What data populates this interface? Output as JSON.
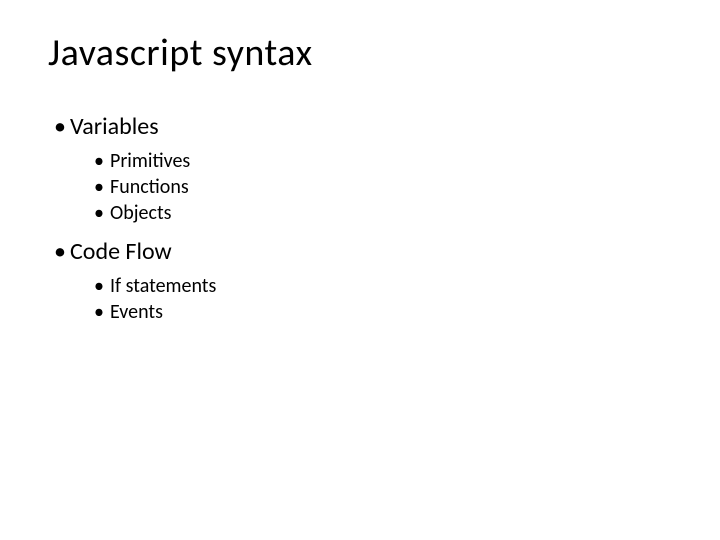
{
  "title": "Javascript syntax",
  "sections": [
    {
      "label": "Variables",
      "items": [
        "Primitives",
        "Functions",
        "Objects"
      ]
    },
    {
      "label": "Code Flow",
      "items": [
        "If statements",
        "Events"
      ]
    }
  ]
}
